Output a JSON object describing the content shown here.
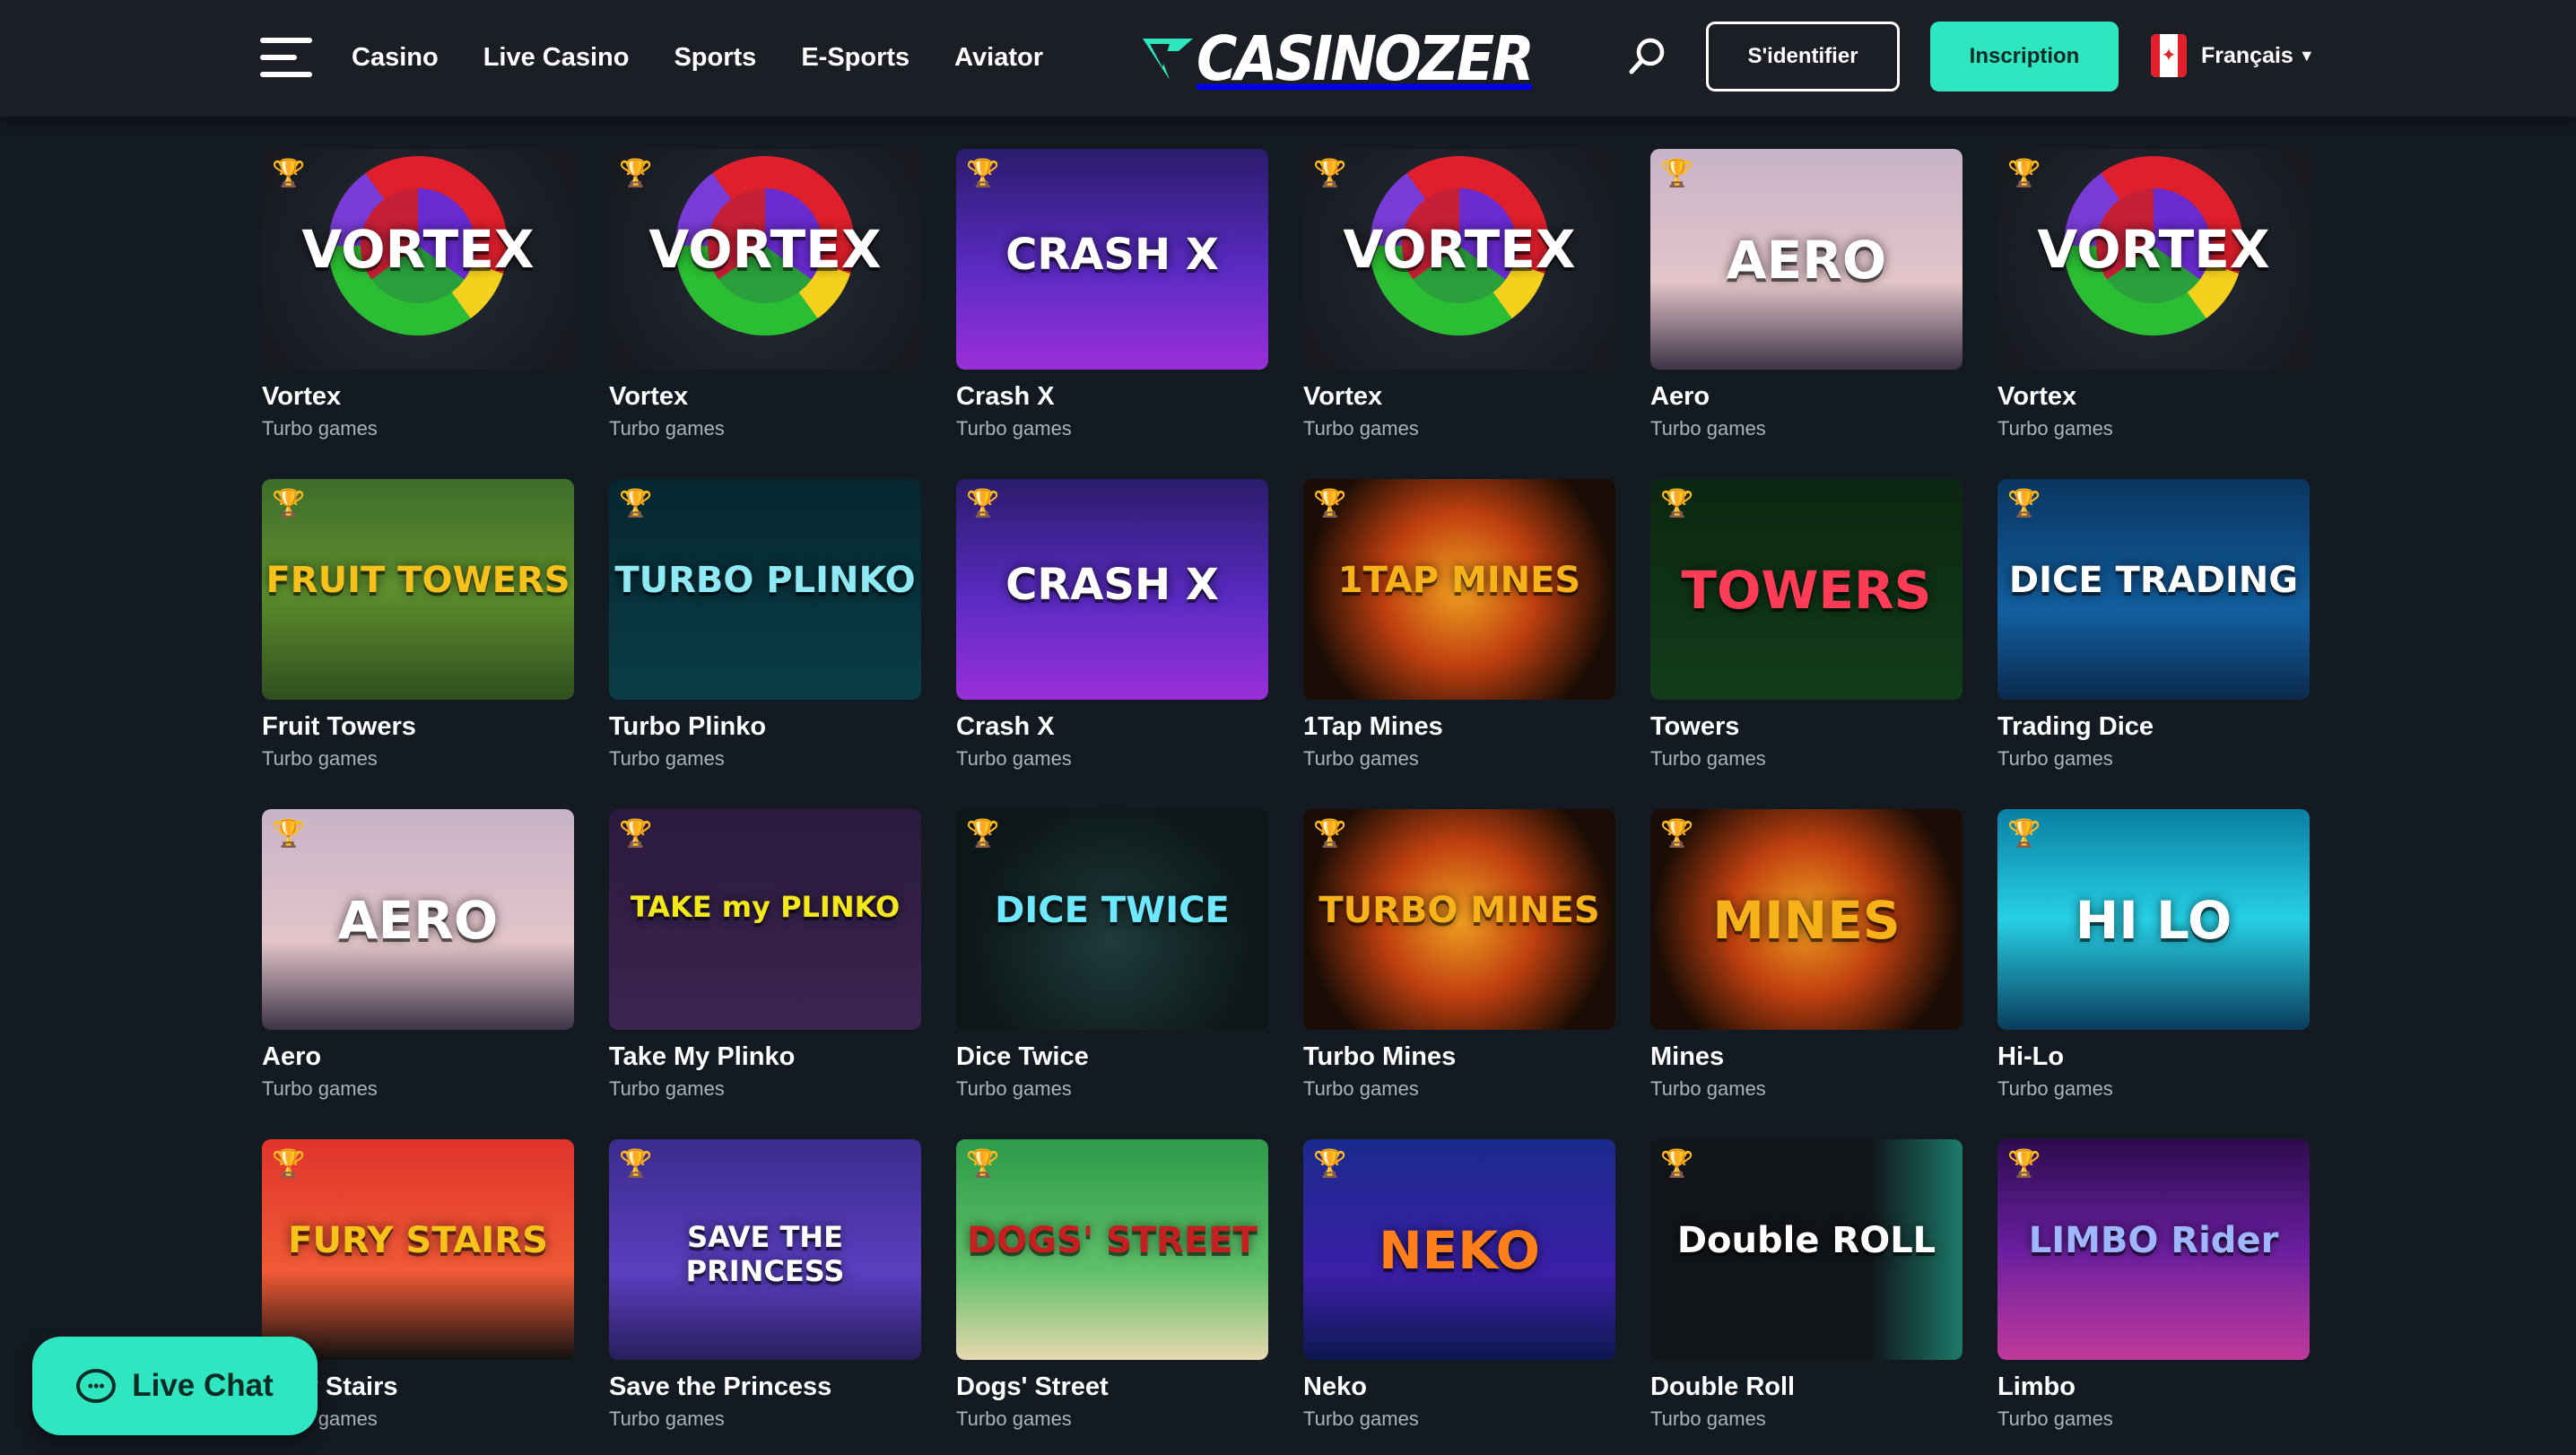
{
  "header": {
    "nav": [
      "Casino",
      "Live Casino",
      "Sports",
      "E-Sports",
      "Aviator"
    ],
    "logo_text": "CASINOZER",
    "login_label": "S'identifier",
    "signup_label": "Inscription",
    "language": "Français",
    "accent_color": "#2ee6bf"
  },
  "games": [
    {
      "name": "Vortex",
      "category": "Turbo games",
      "art": "vortex",
      "art_text": "VORTEX"
    },
    {
      "name": "Vortex",
      "category": "Turbo games",
      "art": "vortex",
      "art_text": "VORTEX"
    },
    {
      "name": "Crash X",
      "category": "Turbo games",
      "art": "crash",
      "art_text": "CRASH X"
    },
    {
      "name": "Vortex",
      "category": "Turbo games",
      "art": "vortex",
      "art_text": "VORTEX"
    },
    {
      "name": "Aero",
      "category": "Turbo games",
      "art": "aero",
      "art_text": "AERO"
    },
    {
      "name": "Vortex",
      "category": "Turbo games",
      "art": "vortex",
      "art_text": "VORTEX"
    },
    {
      "name": "Fruit Towers",
      "category": "Turbo games",
      "art": "fruit",
      "art_text": "FRUIT TOWERS"
    },
    {
      "name": "Turbo Plinko",
      "category": "Turbo games",
      "art": "plinko-turbo",
      "art_text": "TURBO PLINKO"
    },
    {
      "name": "Crash X",
      "category": "Turbo games",
      "art": "crash",
      "art_text": "CRASH X"
    },
    {
      "name": "1Tap Mines",
      "category": "Turbo games",
      "art": "mines",
      "art_text": "1TAP MINES"
    },
    {
      "name": "Towers",
      "category": "Turbo games",
      "art": "towers",
      "art_text": "TOWERS"
    },
    {
      "name": "Trading Dice",
      "category": "Turbo games",
      "art": "dice-trading",
      "art_text": "DICE TRADING"
    },
    {
      "name": "Aero",
      "category": "Turbo games",
      "art": "aero",
      "art_text": "AERO"
    },
    {
      "name": "Take My Plinko",
      "category": "Turbo games",
      "art": "take-plinko",
      "art_text": "TAKE my PLINKO"
    },
    {
      "name": "Dice Twice",
      "category": "Turbo games",
      "art": "dice-twice",
      "art_text": "DICE TWICE"
    },
    {
      "name": "Turbo Mines",
      "category": "Turbo games",
      "art": "mines",
      "art_text": "TURBO MINES"
    },
    {
      "name": "Mines",
      "category": "Turbo games",
      "art": "mines",
      "art_text": "MINES"
    },
    {
      "name": "Hi-Lo",
      "category": "Turbo games",
      "art": "hilo",
      "art_text": "HI LO"
    },
    {
      "name": "Fury Stairs",
      "category": "Turbo games",
      "art": "fury",
      "art_text": "FURY STAIRS"
    },
    {
      "name": "Save the Princess",
      "category": "Turbo games",
      "art": "princess",
      "art_text": "SAVE THE PRINCESS"
    },
    {
      "name": "Dogs' Street",
      "category": "Turbo games",
      "art": "dogs",
      "art_text": "DOGS' STREET"
    },
    {
      "name": "Neko",
      "category": "Turbo games",
      "art": "neko",
      "art_text": "NEKO"
    },
    {
      "name": "Double Roll",
      "category": "Turbo games",
      "art": "double",
      "art_text": "Double ROLL"
    },
    {
      "name": "Limbo",
      "category": "Turbo games",
      "art": "limbo",
      "art_text": "LIMBO Rider"
    }
  ],
  "live_chat": {
    "label": "Live Chat"
  }
}
